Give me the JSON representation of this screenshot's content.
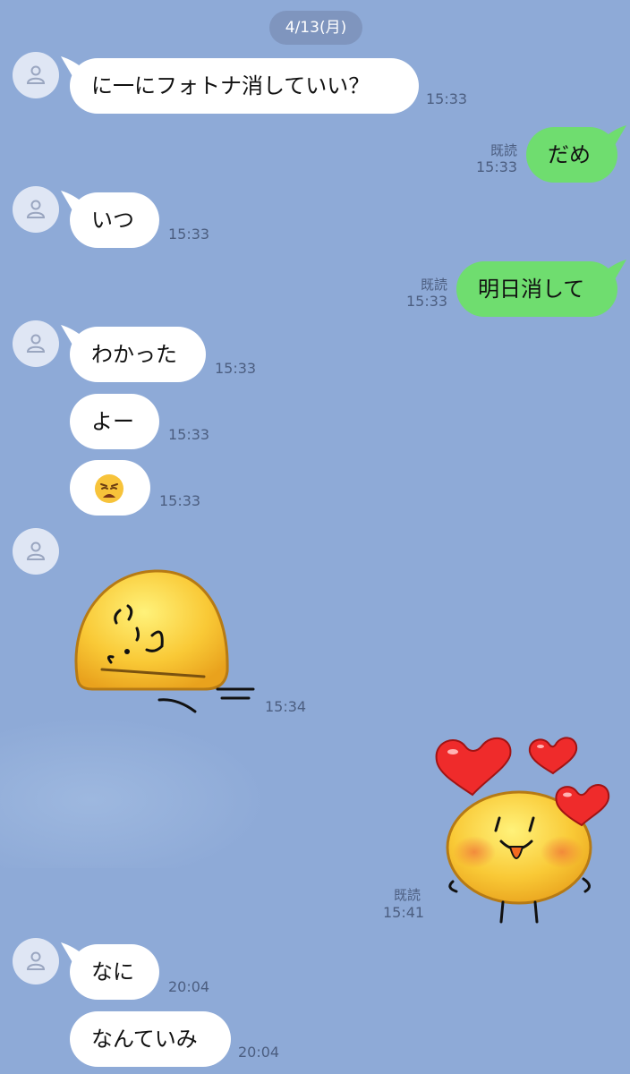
{
  "date_label": "4/13(月)",
  "read_label": "既読",
  "messages": [
    {
      "text": "に一にフォトナ消していい？",
      "time": "15:33"
    },
    {
      "text": "だめ",
      "time": "15:33"
    },
    {
      "text": "いつ",
      "time": "15:33"
    },
    {
      "text": "明日消して",
      "time": "15:33"
    },
    {
      "text": "わかった",
      "time": "15:33"
    },
    {
      "text": "よー",
      "time": "15:33"
    },
    {
      "text": "weary-face-emoji",
      "time": "15:33"
    },
    {
      "text": "sticker-lying-blob",
      "time": "15:34"
    },
    {
      "text": "sticker-hearts-blob",
      "time": "15:41"
    },
    {
      "text": "なに",
      "time": "20:04"
    },
    {
      "text": "なんていみ",
      "time": "20:04"
    }
  ],
  "colors": {
    "background": "#8eaad7",
    "incoming_bubble": "#ffffff",
    "outgoing_bubble": "#6fdd6f",
    "date_pill": "#7f95be",
    "meta_text": "#4c5e80"
  }
}
